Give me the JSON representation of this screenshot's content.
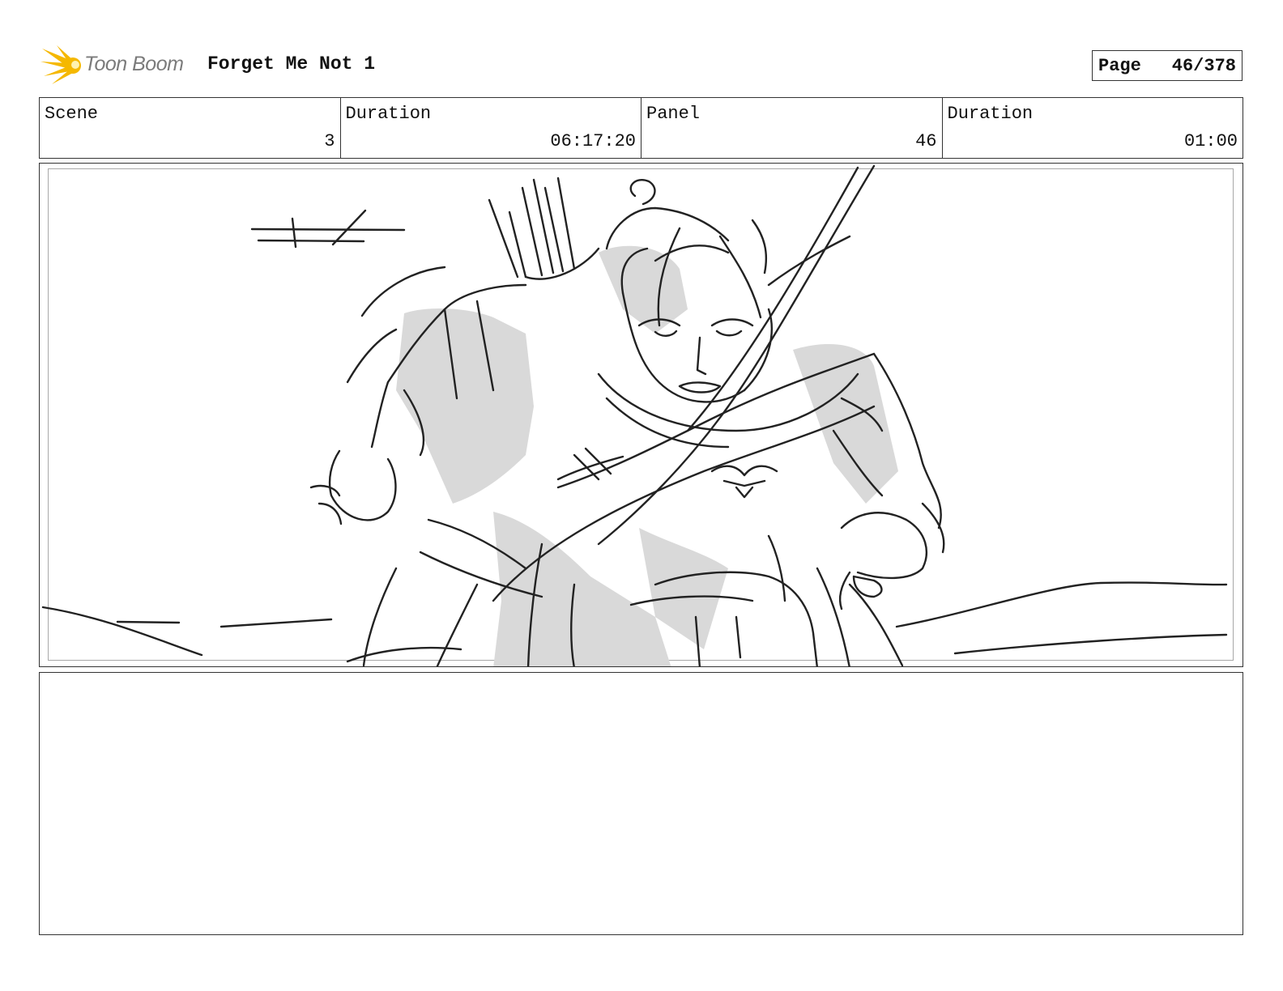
{
  "header": {
    "logo_text": "Toon Boom",
    "project_title": "Forget Me Not 1",
    "page_label": "Page",
    "page_number": "46/378"
  },
  "info": {
    "scene_label": "Scene",
    "scene_value": "3",
    "scene_duration_label": "Duration",
    "scene_duration_value": "06:17:20",
    "panel_label": "Panel",
    "panel_value": "46",
    "panel_duration_label": "Duration",
    "panel_duration_value": "01:00"
  },
  "panel": {
    "image_icon": "storyboard-sketch"
  },
  "notes": {
    "text": ""
  },
  "colors": {
    "logo_flare": "#f5b800",
    "logo_text": "#7b7b7b",
    "border": "#333333",
    "sketch_shade": "#d9d9d9",
    "sketch_line": "#222222"
  }
}
